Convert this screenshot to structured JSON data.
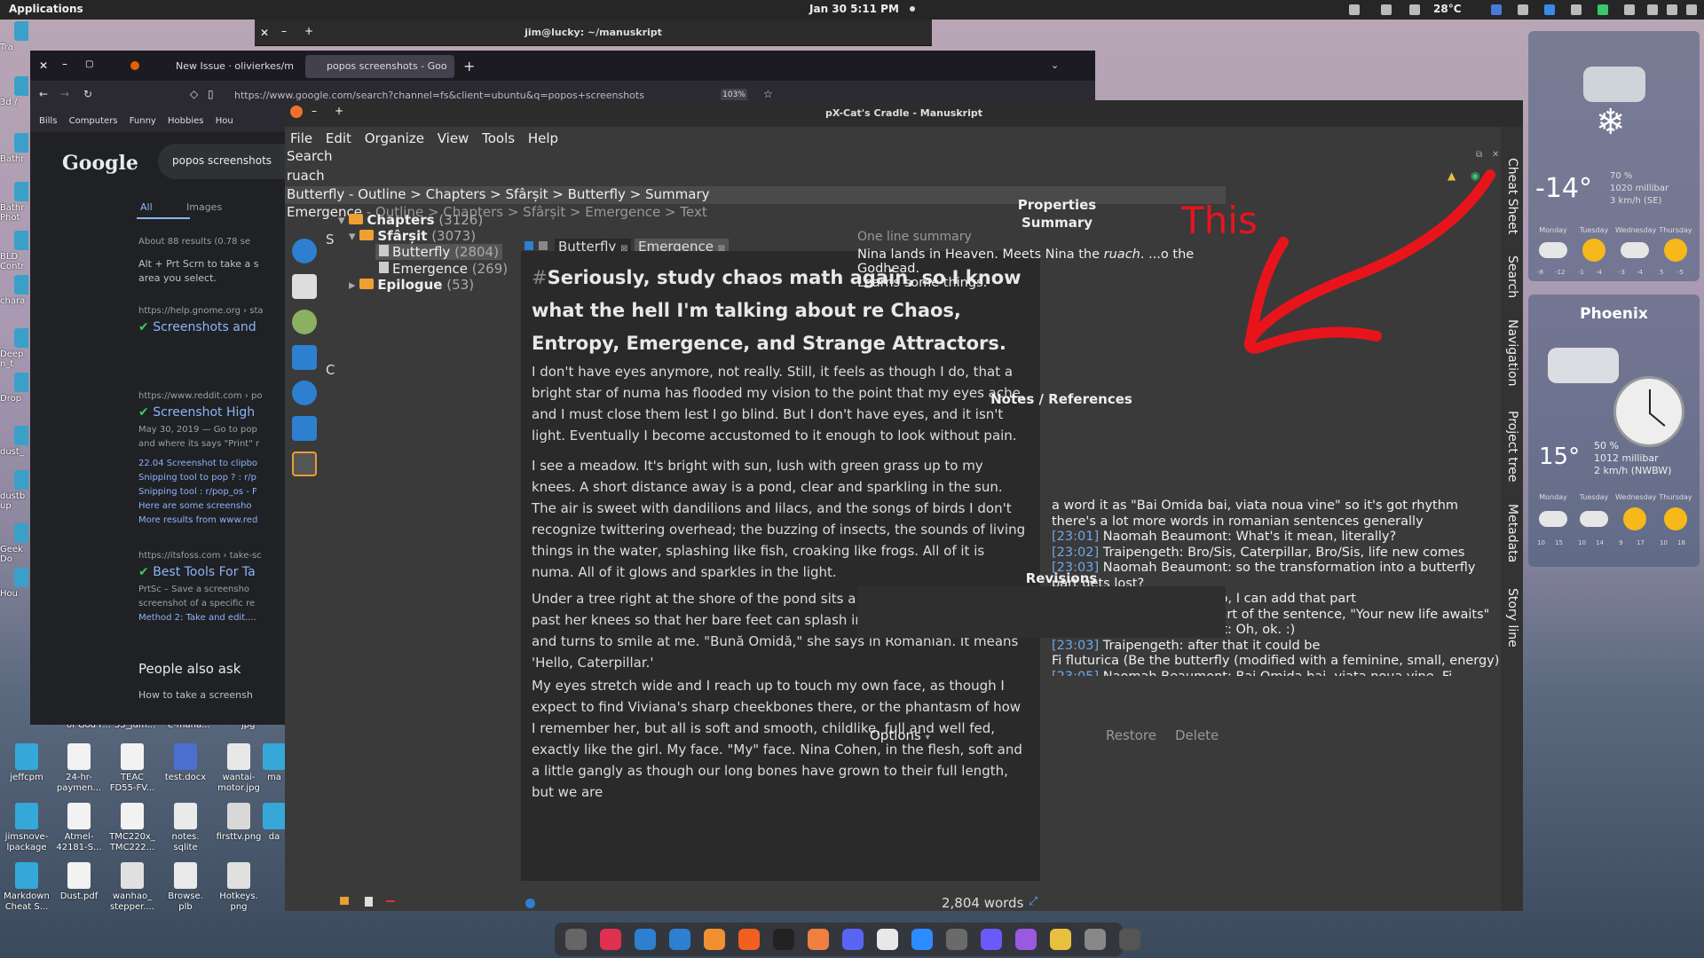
{
  "topbar": {
    "applications": "Applications",
    "clock": "Jan 30  5:11 PM",
    "temperature": "28°C"
  },
  "desktop": {
    "left_labels": [
      "Tra",
      "3d /",
      "Bathr",
      "Bathr Phot",
      "BLD Contr",
      "chara",
      "Deep n_t",
      "Drop",
      "dust_",
      "dustb up",
      "Geek Do",
      "Hou"
    ],
    "icons": [
      {
        "label": "jeffcpm",
        "color": "#35a8d8"
      },
      {
        "label": "24-hr-\npaymen...",
        "color": "#f2f2f2"
      },
      {
        "label": "TEAC\nFD55-FV...",
        "color": "#f2f2f2"
      },
      {
        "label": "test.docx",
        "color": "#4a6fd0"
      },
      {
        "label": "wantai-\nmotor.jpg",
        "color": "#e8e8e8"
      },
      {
        "label": "ma",
        "color": "#35a8d8"
      },
      {
        "label": "jimsnove-\nlpackage",
        "color": "#35a8d8"
      },
      {
        "label": "Atmel-\n42181-S...",
        "color": "#f2f2f2"
      },
      {
        "label": "TMC220x_\nTMC222...",
        "color": "#f2f2f2"
      },
      {
        "label": "notes.\nsqlite",
        "color": "#eaeaea"
      },
      {
        "label": "firsttv.png",
        "color": "#d8d8d8"
      },
      {
        "label": "da",
        "color": "#35a8d8"
      },
      {
        "label": "Markdown\nCheat S...",
        "color": "#35a8d8"
      },
      {
        "label": "Dust.pdf",
        "color": "#f2f2f2"
      },
      {
        "label": "wanhao_\nstepper....",
        "color": "#e0e0e0"
      },
      {
        "label": "Browse.\nplb",
        "color": "#eaeaea"
      },
      {
        "label": "Hotkeys.\npng",
        "color": "#e0e0e0"
      }
    ],
    "partial_labels": [
      "of God F...",
      "55_jum...",
      "e-mana...",
      "jpg"
    ]
  },
  "terminal": {
    "title": "jim@lucky: ~/manuskript"
  },
  "firefox": {
    "tabs": [
      "New Issue · olivierkes/m",
      "popos screenshots - Goo"
    ],
    "url": "https://www.google.com/search?channel=fs&client=ubuntu&q=popos+screenshots",
    "zoom": "103%",
    "bookmarks": [
      "Bills",
      "Computers",
      "Funny",
      "Hobbies",
      "Hou"
    ],
    "google": {
      "logo": "Google",
      "query": "popos screenshots",
      "tab_all": "All",
      "tab_images": "Images",
      "results_count": "About 88 results (0.78 se",
      "snippet1": [
        "Alt + Prt Scrn to take a s",
        "area you select."
      ],
      "r1_url": "https://help.gnome.org › sta",
      "r1_title": "Screenshots and",
      "r2_url": "https://www.reddit.com › po",
      "r2_title": "Screenshot High",
      "r2_lines": [
        "May 30, 2019 — Go to pop",
        "and where its says \"Print\" r"
      ],
      "r2_links": [
        "22.04 Screenshot to clipbo",
        "Snipping tool to pop ? : r/p",
        "Snipping tool : r/pop_os - F",
        "Here are some screensho",
        "More results from www.red"
      ],
      "r3_url": "https://itsfoss.com › take-sc",
      "r3_title": "Best Tools For Ta",
      "r3_lines": [
        "PrtSc – Save a screensho",
        "screenshot of a specific re"
      ],
      "r3_link": "Method 2: Take and edit....",
      "paa": "People also ask",
      "paa_q": "How to take a screensh"
    }
  },
  "manuskript": {
    "title": "pX-Cat's Cradle - Manuskript",
    "menu": [
      "File",
      "Edit",
      "Organize",
      "View",
      "Tools",
      "Help"
    ],
    "search_label": "Search",
    "search_value": "ruach",
    "result1": "Butterfly - Outline > Chapters > Sfârșit > Butterfly > Summary",
    "result2_title": "Emergence",
    "result2_path": " - Outline > Chapters > Sfârșit > Emergence > Text",
    "side_tabs": [
      "Cheat Sheet",
      "Search",
      "Navigation",
      "Project tree",
      "Metadata",
      "Story line"
    ],
    "tree": [
      {
        "name": "Chapters",
        "count": "(3126)"
      },
      {
        "name": "Sfârșit",
        "count": "(3073)"
      },
      {
        "name": "Butterfly",
        "count": "(2804)"
      },
      {
        "name": "Emergence",
        "count": "(269)"
      },
      {
        "name": "Epilogue",
        "count": "(53)"
      }
    ],
    "tree_cut": [
      "S",
      "C"
    ],
    "editor_tabs": [
      "Butterfly",
      "Emergence"
    ],
    "heading_hash": "#",
    "heading": "Seriously, study chaos math again, so I know what the hell I'm talking about re Chaos, Entropy, Emergence, and Strange Attractors.",
    "paragraphs": [
      "I don't have eyes anymore, not really. Still, it feels as though I do, that a bright star of numa has flooded my vision to the point that my eyes ache, and I must close them lest I go blind. But I don't have eyes, and it isn't light. Eventually I become accustomed to it enough to look without pain.",
      "I see a meadow. It's bright with sun, lush with green grass up to my knees. A short distance away is a pond, clear and sparkling in the sun. The air is sweet with dandilions and lilacs, and the songs of birds I don't recognize twittering overhead; the buzzing of insects, the sounds of living things in the water, splashing like fish, croaking like frogs. All of it is numa. All of it glows and sparkles in the light.",
      "Under a tree right at the shore of the pond sits a girl, her skirt hiked up past her knees so that her bare feet can splash in the water. She laughs and turns to smile at me. \"Bună Omidă,\" she says in Romanian. It means 'Hello, Caterpillar.'",
      "My eyes stretch wide and I reach up to touch my own face, as though I expect to find Viviana's sharp cheekbones there, or the phantasm of how I remember her, but all is soft and smooth, childlike, full and well fed, exactly like the girl. My face. \"My\" face. Nina Cohen, in the flesh, soft and a little gangly as though our long bones have grown to their full length, but we are"
    ],
    "word_count": "2,804 words",
    "properties": {
      "title": "Properties",
      "summary_label": "Summary",
      "placeholder": "One line summary",
      "summary_text": "Nina lands in Heaven. Meets Nina the ",
      "summary_em": "ruach",
      "summary_tail": ". ...o the Godhead.",
      "summary_line2": "Learns some things.",
      "notes_title": "Notes / References",
      "notes": [
        {
          "ts": "",
          "text": "a word it as \"Bai Omida bai, viata noua vine\" so it's got rhythm"
        },
        {
          "ts": "",
          "text": "there's a lot more words in romanian sentences generally"
        },
        {
          "ts": "[23:01]",
          "text": " Naomah Beaumont: What's it mean, literally?"
        },
        {
          "ts": "[23:02]",
          "text": " Traipengeth: Bro/Sis, Caterpillar, Bro/Sis, life new comes"
        },
        {
          "ts": "[23:03]",
          "text": " Naomah Beaumont: so the transformation into a butterfly part gets lost?"
        },
        {
          "ts": "[23:03]",
          "text": " Traipengeth: oh, no, I can add that part"
        },
        {
          "ts": "",
          "text": "I was just doing the first part of the sentence, \"Your new life awaits\""
        },
        {
          "ts": "[23:03]",
          "text": " Naomah Beaumont: Oh, ok. :)"
        },
        {
          "ts": "[23:03]",
          "text": " Traipengeth: after that it could be"
        },
        {
          "ts": "",
          "text": "Fi fluturica (Be the butterfly (modified with a feminine, small, energy)"
        },
        {
          "ts": "[23:05]",
          "text": " Naomah Beaumont: Bai Omida bai, viata noua vine. Fi fluturica.  Like that?"
        }
      ],
      "revisions": "Revisions",
      "options": "Options",
      "restore": "Restore",
      "delete": "Delete"
    },
    "annotation": "This"
  },
  "weather": {
    "w1": {
      "temp": "-14°",
      "pressure": "1020 millibar",
      "wind": "3 km/h (SE)",
      "humid": "70 %",
      "days": [
        "Monday",
        "Tuesday",
        "Wednesday",
        "Thursday"
      ],
      "highs": [
        "-8",
        "-1",
        "-3",
        "5"
      ],
      "lows": [
        "-12",
        "-4",
        "-4",
        "-5"
      ]
    },
    "w2": {
      "city": "Phoenix",
      "temp": "15°",
      "humid": "50 %",
      "pressure": "1012 millibar",
      "wind": "2 km/h (NWBW)",
      "days": [
        "Monday",
        "Tuesday",
        "Wednesday",
        "Thursday"
      ],
      "highs": [
        "10",
        "10",
        "9",
        "10"
      ],
      "lows": [
        "15",
        "14",
        "17",
        "18"
      ]
    }
  },
  "dock": {
    "apps": [
      "Files",
      "Calculator",
      "Thunderbird",
      "Vinyl",
      "Flashcards",
      "Firefox",
      "Terminal",
      "Stacks",
      "Discord",
      "Slack",
      "Zoom",
      "Chicken",
      "Logos",
      "Viber",
      "Apps",
      "Settings",
      "Manuskript"
    ]
  }
}
